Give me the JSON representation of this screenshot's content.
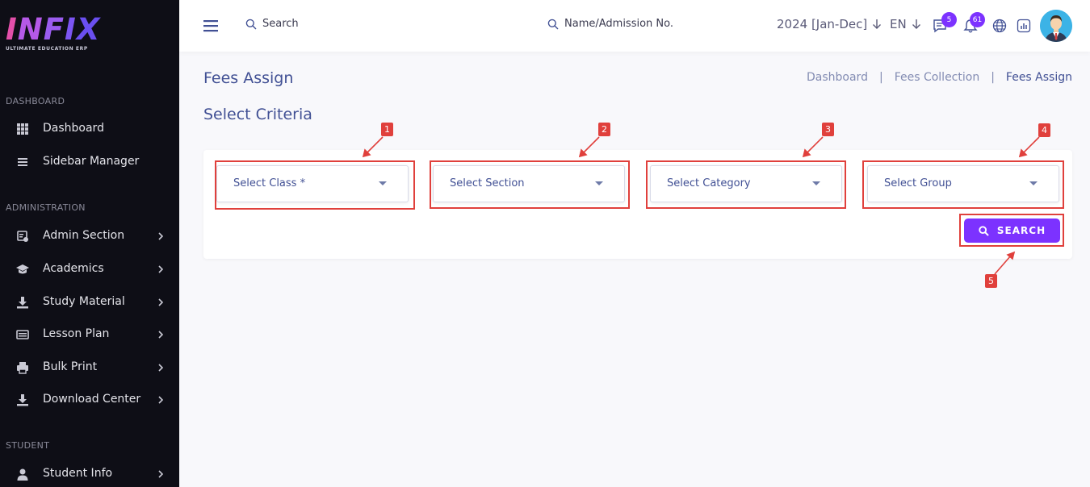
{
  "brand": {
    "logo": "INFIX",
    "tagline": "ULTIMATE EDUCATION ERP"
  },
  "sidebar": {
    "sections": [
      {
        "title": "DASHBOARD",
        "items": [
          {
            "label": "Dashboard",
            "icon": "grid-icon",
            "has_children": false
          },
          {
            "label": "Sidebar Manager",
            "icon": "menu-lines-icon",
            "has_children": false
          }
        ]
      },
      {
        "title": "ADMINISTRATION",
        "items": [
          {
            "label": "Admin Section",
            "icon": "admin-icon",
            "has_children": true
          },
          {
            "label": "Academics",
            "icon": "graduation-cap-icon",
            "has_children": true
          },
          {
            "label": "Study Material",
            "icon": "download-tray-icon",
            "has_children": true
          },
          {
            "label": "Lesson Plan",
            "icon": "lesson-icon",
            "has_children": true
          },
          {
            "label": "Bulk Print",
            "icon": "printer-icon",
            "has_children": true
          },
          {
            "label": "Download Center",
            "icon": "download-tray-icon",
            "has_children": true
          }
        ]
      },
      {
        "title": "STUDENT",
        "items": [
          {
            "label": "Student Info",
            "icon": "user-icon",
            "has_children": true
          }
        ]
      }
    ]
  },
  "topbar": {
    "search_label": "Search",
    "student_search_label": "Name/Admission No.",
    "academic_year": "2024 [Jan-Dec]",
    "language": "EN",
    "messages_count": "5",
    "notifications_count": "61"
  },
  "page": {
    "title": "Fees Assign",
    "breadcrumb": [
      "Dashboard",
      "Fees Collection",
      "Fees Assign"
    ],
    "section_title": "Select Criteria"
  },
  "form": {
    "class_placeholder": "Select Class *",
    "section_placeholder": "Select Section",
    "category_placeholder": "Select Category",
    "group_placeholder": "Select Group",
    "search_button": "SEARCH"
  },
  "annotations": [
    "1",
    "2",
    "3",
    "4",
    "5"
  ],
  "colors": {
    "accent": "#7c32ff",
    "highlight": "#e0403c",
    "text_primary": "#415094",
    "sidebar_bg": "#0e0e16"
  }
}
